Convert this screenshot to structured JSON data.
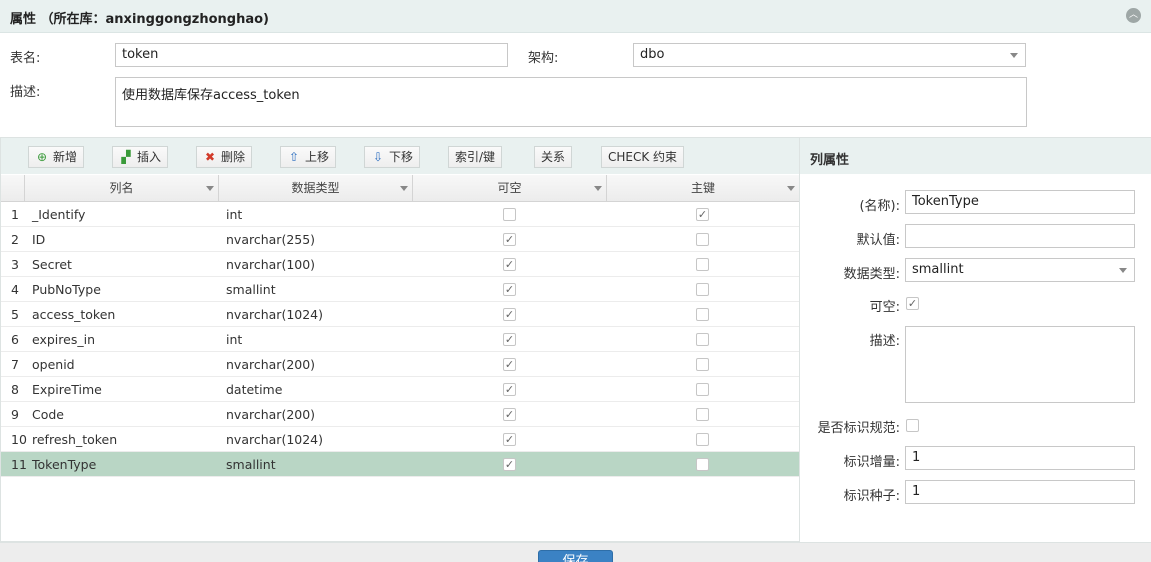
{
  "header": {
    "title": "属性 （所在库：anxinggongzhonghao)"
  },
  "form": {
    "table_name_label": "表名:",
    "table_name_value": "token",
    "schema_label": "架构:",
    "schema_value": "dbo",
    "description_label": "描述:",
    "description_value": "使用数据库保存access_token"
  },
  "toolbar": {
    "add": "新增",
    "insert": "插入",
    "delete": "删除",
    "move_up": "上移",
    "move_down": "下移",
    "index_key": "索引/键",
    "relation": "关系",
    "check": "CHECK 约束"
  },
  "grid": {
    "headers": {
      "name": "列名",
      "type": "数据类型",
      "nullable": "可空",
      "pk": "主键"
    },
    "rows": [
      {
        "idx": "1",
        "name": "_Identify",
        "type": "int",
        "nullable": false,
        "pk": true
      },
      {
        "idx": "2",
        "name": "ID",
        "type": "nvarchar(255)",
        "nullable": true,
        "pk": false
      },
      {
        "idx": "3",
        "name": "Secret",
        "type": "nvarchar(100)",
        "nullable": true,
        "pk": false
      },
      {
        "idx": "4",
        "name": "PubNoType",
        "type": "smallint",
        "nullable": true,
        "pk": false
      },
      {
        "idx": "5",
        "name": "access_token",
        "type": "nvarchar(1024)",
        "nullable": true,
        "pk": false
      },
      {
        "idx": "6",
        "name": "expires_in",
        "type": "int",
        "nullable": true,
        "pk": false
      },
      {
        "idx": "7",
        "name": "openid",
        "type": "nvarchar(200)",
        "nullable": true,
        "pk": false
      },
      {
        "idx": "8",
        "name": "ExpireTime",
        "type": "datetime",
        "nullable": true,
        "pk": false
      },
      {
        "idx": "9",
        "name": "Code",
        "type": "nvarchar(200)",
        "nullable": true,
        "pk": false
      },
      {
        "idx": "10",
        "name": "refresh_token",
        "type": "nvarchar(1024)",
        "nullable": true,
        "pk": false
      },
      {
        "idx": "11",
        "name": "TokenType",
        "type": "smallint",
        "nullable": true,
        "pk": false,
        "selected": true
      }
    ]
  },
  "column_props": {
    "title": "列属性",
    "name_label": "(名称):",
    "name_value": "TokenType",
    "default_label": "默认值:",
    "default_value": "",
    "type_label": "数据类型:",
    "type_value": "smallint",
    "nullable_label": "可空:",
    "nullable_checked": true,
    "desc_label": "描述:",
    "desc_value": "",
    "identity_label": "是否标识规范:",
    "identity_checked": false,
    "increment_label": "标识增量:",
    "increment_value": "1",
    "seed_label": "标识种子:",
    "seed_value": "1"
  },
  "footer": {
    "save_label": "保存"
  },
  "colors": {
    "accent": "#3b82c4",
    "selected_row": "#b9d6c5",
    "panel_header": "#e9f1f0"
  }
}
